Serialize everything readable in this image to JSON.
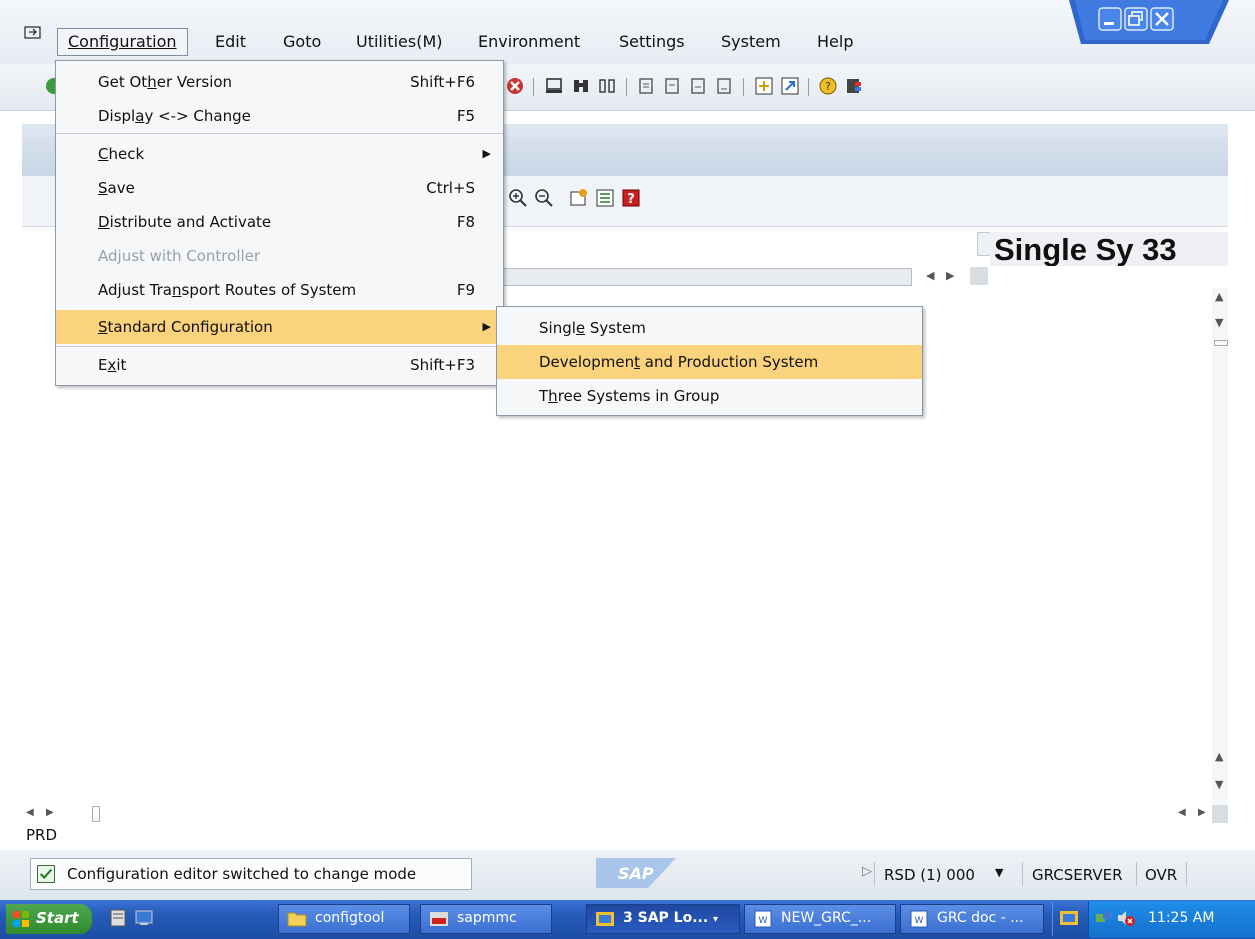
{
  "menubar": {
    "items": [
      "Configuration",
      "Edit",
      "Goto",
      "Utilities(M)",
      "Environment",
      "Settings",
      "System",
      "Help"
    ]
  },
  "config_menu": {
    "items": [
      {
        "label": "Get Other Version",
        "shortcut": "Shift+F6"
      },
      {
        "label": "Display <-> Change",
        "shortcut": "F5"
      },
      {
        "label": "Check",
        "shortcut": ""
      },
      {
        "label": "Save",
        "shortcut": "Ctrl+S"
      },
      {
        "label": "Distribute and Activate",
        "shortcut": "F8"
      },
      {
        "label": "Adjust with Controller",
        "shortcut": ""
      },
      {
        "label": "Adjust Transport Routes of System",
        "shortcut": "F9"
      },
      {
        "label": "Standard Configuration",
        "shortcut": ""
      },
      {
        "label": "Exit",
        "shortcut": "Shift+F3"
      }
    ]
  },
  "submenu": {
    "items": [
      "Single System",
      "Development and Production System",
      "Three Systems in Group"
    ]
  },
  "work": {
    "side_title": "Single Sy 33",
    "status_label": "PRD"
  },
  "statusbar": {
    "message": "Configuration editor switched to change mode",
    "system": "RSD (1) 000",
    "server": "GRCSERVER",
    "mode": "OVR",
    "logo": "SAP"
  },
  "taskbar": {
    "start": "Start",
    "buttons": [
      "configtool",
      "sapmmc",
      "3 SAP Lo...",
      "NEW_GRC_...",
      "GRC doc - ..."
    ],
    "clock": "11:25 AM"
  }
}
